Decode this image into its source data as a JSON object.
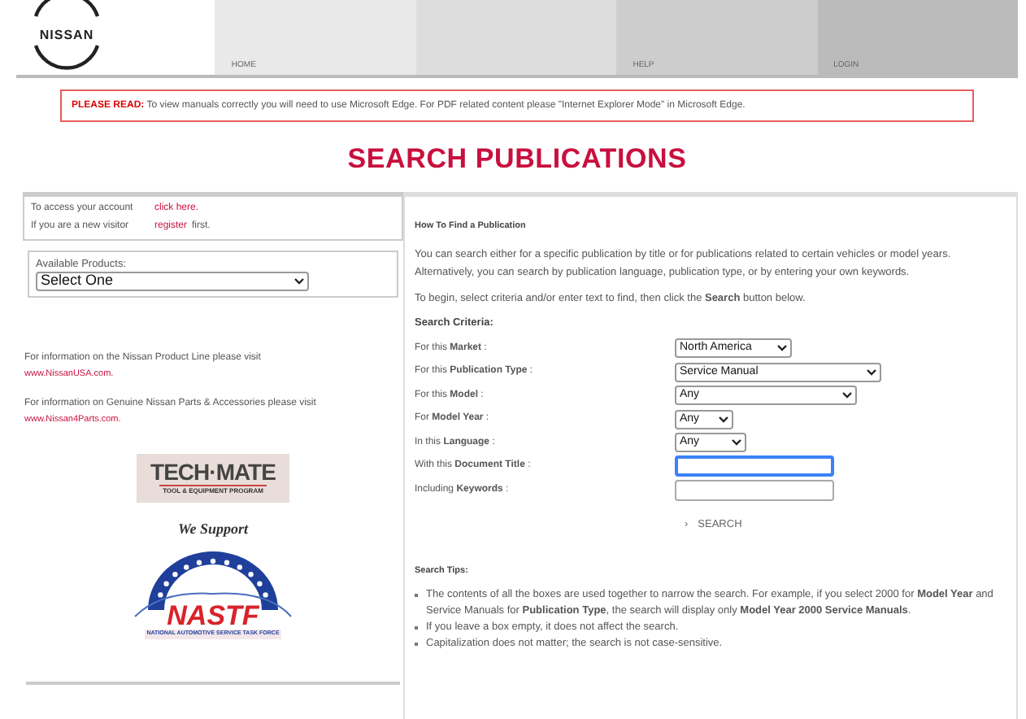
{
  "brand": {
    "wordmark": "NISSAN"
  },
  "nav": [
    {
      "label": "HOME"
    },
    {
      "label": "HELP"
    },
    {
      "label": "LOGIN"
    }
  ],
  "notice": {
    "lead": "PLEASE READ:",
    "text": "To view manuals correctly you will need to use Microsoft Edge. For PDF related content please \"Internet Explorer Mode\" in Microsoft Edge."
  },
  "title": "SEARCH PUBLICATIONS",
  "account": [
    {
      "text": "To access your account",
      "link": "click here."
    },
    {
      "text": "If you are a new visitor",
      "link": "register",
      "after": "first."
    }
  ],
  "products": {
    "label": "Available Products:",
    "value": "Select One"
  },
  "info": [
    {
      "text": "For information on the Nissan Product Line please visit",
      "link": "www.NissanUSA.com."
    },
    {
      "text": "For information on Genuine Nissan Parts & Accessories please visit",
      "link": "www.Nissan4Parts.com."
    }
  ],
  "techmate": {
    "name": "TECH·MATE",
    "tagline": "TOOL & EQUIPMENT PROGRAM"
  },
  "support": {
    "heading": "We Support",
    "name": "NASTF",
    "tagline": "NATIONAL AUTOMOTIVE SERVICE TASK FORCE"
  },
  "howto": {
    "heading": "How To Find a Publication",
    "paragraphs": [
      "You can search either for a specific publication by title or for publications related to certain vehicles or model years. Alternatively, you can search by publication language, publication type, or by entering your own keywords.",
      "To begin, select criteria and/or enter text to find, then click the **Search** button below."
    ]
  },
  "criteria": {
    "heading": "Search Criteria:",
    "rows": [
      {
        "label": "For this **Market** :",
        "kind": "select",
        "value": "North America"
      },
      {
        "label": "For this **Publication Type** :",
        "kind": "select",
        "value": "Service Manual"
      },
      {
        "label": "For this **Model** :",
        "kind": "select",
        "value": "Any"
      },
      {
        "label": "For **Model Year** :",
        "kind": "select",
        "value": "Any"
      },
      {
        "label": "In this **Language** :",
        "kind": "select",
        "value": "Any"
      },
      {
        "label": "With this **Document Title** :",
        "kind": "input",
        "focused": true
      },
      {
        "label": "Including **Keywords** :",
        "kind": "input",
        "focused": false
      }
    ],
    "button": {
      "arrow": "›",
      "label": "SEARCH"
    }
  },
  "tips": {
    "heading": "Search Tips:",
    "items": [
      "The contents of all the boxes are used together to narrow the search. For example, if you select 2000 for **Model Year** and Service Manuals for **Publication Type**, the search will display only **Model Year 2000 Service Manuals**.",
      "If you leave a box empty, it does not affect the search.",
      "Capitalization does not matter; the search is not case-sensitive."
    ]
  }
}
